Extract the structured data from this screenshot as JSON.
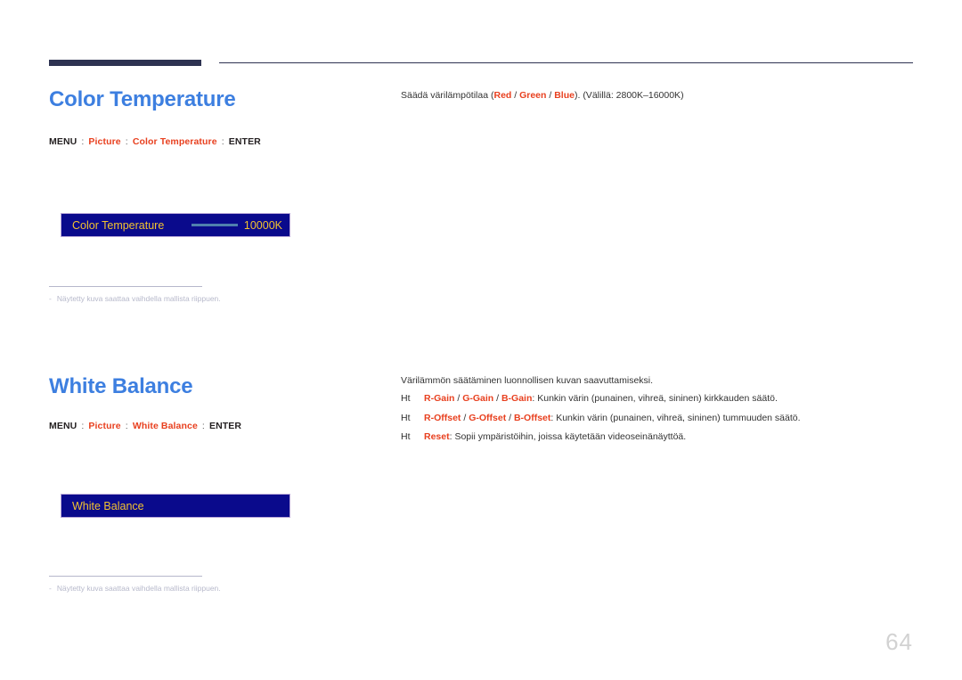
{
  "page": {
    "number": "64"
  },
  "sections": [
    {
      "title": "Color Temperature",
      "menu_path": {
        "start": "MENU",
        "sep": ":",
        "items": [
          "Picture",
          "Color Temperature"
        ],
        "end": "ENTER"
      },
      "osd": {
        "label": "Color Temperature",
        "value": "10000K",
        "has_slider": true
      },
      "footnote": {
        "dash": "-",
        "text": "Näytetty kuva saattaa vaihdella mallista riippuen."
      },
      "description": {
        "prefix": "Säädä värilämpötilaa (",
        "red1": "Red",
        "slash1": " / ",
        "red2": "Green",
        "slash2": " / ",
        "red3": "Blue",
        "suffix": "). (Välillä: 2800K–16000K)"
      },
      "bullets": []
    },
    {
      "title": "White Balance",
      "menu_path": {
        "start": "MENU",
        "sep": ":",
        "items": [
          "Picture",
          "White Balance"
        ],
        "end": "ENTER"
      },
      "osd": {
        "label": "White Balance",
        "value": "",
        "has_slider": false
      },
      "footnote": {
        "dash": "-",
        "text": "Näytetty kuva saattaa vaihdella mallista riippuen."
      },
      "description": {
        "prefix": "Värilämmön säätäminen luonnollisen kuvan saavuttamiseksi.",
        "red1": "",
        "slash1": "",
        "red2": "",
        "slash2": "",
        "red3": "",
        "suffix": ""
      },
      "bullets": [
        {
          "marker": "Ht",
          "red1": "R-Gain",
          "slash1": " / ",
          "red2": "G-Gain",
          "slash2": " / ",
          "red3": "B-Gain",
          "rest": ": Kunkin värin (punainen, vihreä, sininen) kirkkauden säätö."
        },
        {
          "marker": "Ht",
          "red1": "R-Offset",
          "slash1": " / ",
          "red2": "G-Offset",
          "slash2": " / ",
          "red3": "B-Offset",
          "rest": ": Kunkin värin (punainen, vihreä, sininen) tummuuden säätö."
        },
        {
          "marker": "Ht",
          "red1": "Reset",
          "slash1": "",
          "red2": "",
          "slash2": "",
          "red3": "",
          "rest": ": Sopii ympäristöihin, joissa käytetään videoseinänäyttöä."
        }
      ]
    }
  ],
  "colors": {
    "heading_blue": "#3d7fe0",
    "accent_red": "#e8401f",
    "osd_background": "#0a0a8c",
    "osd_text": "#f2c230",
    "rule_navy": "#2e3352"
  }
}
